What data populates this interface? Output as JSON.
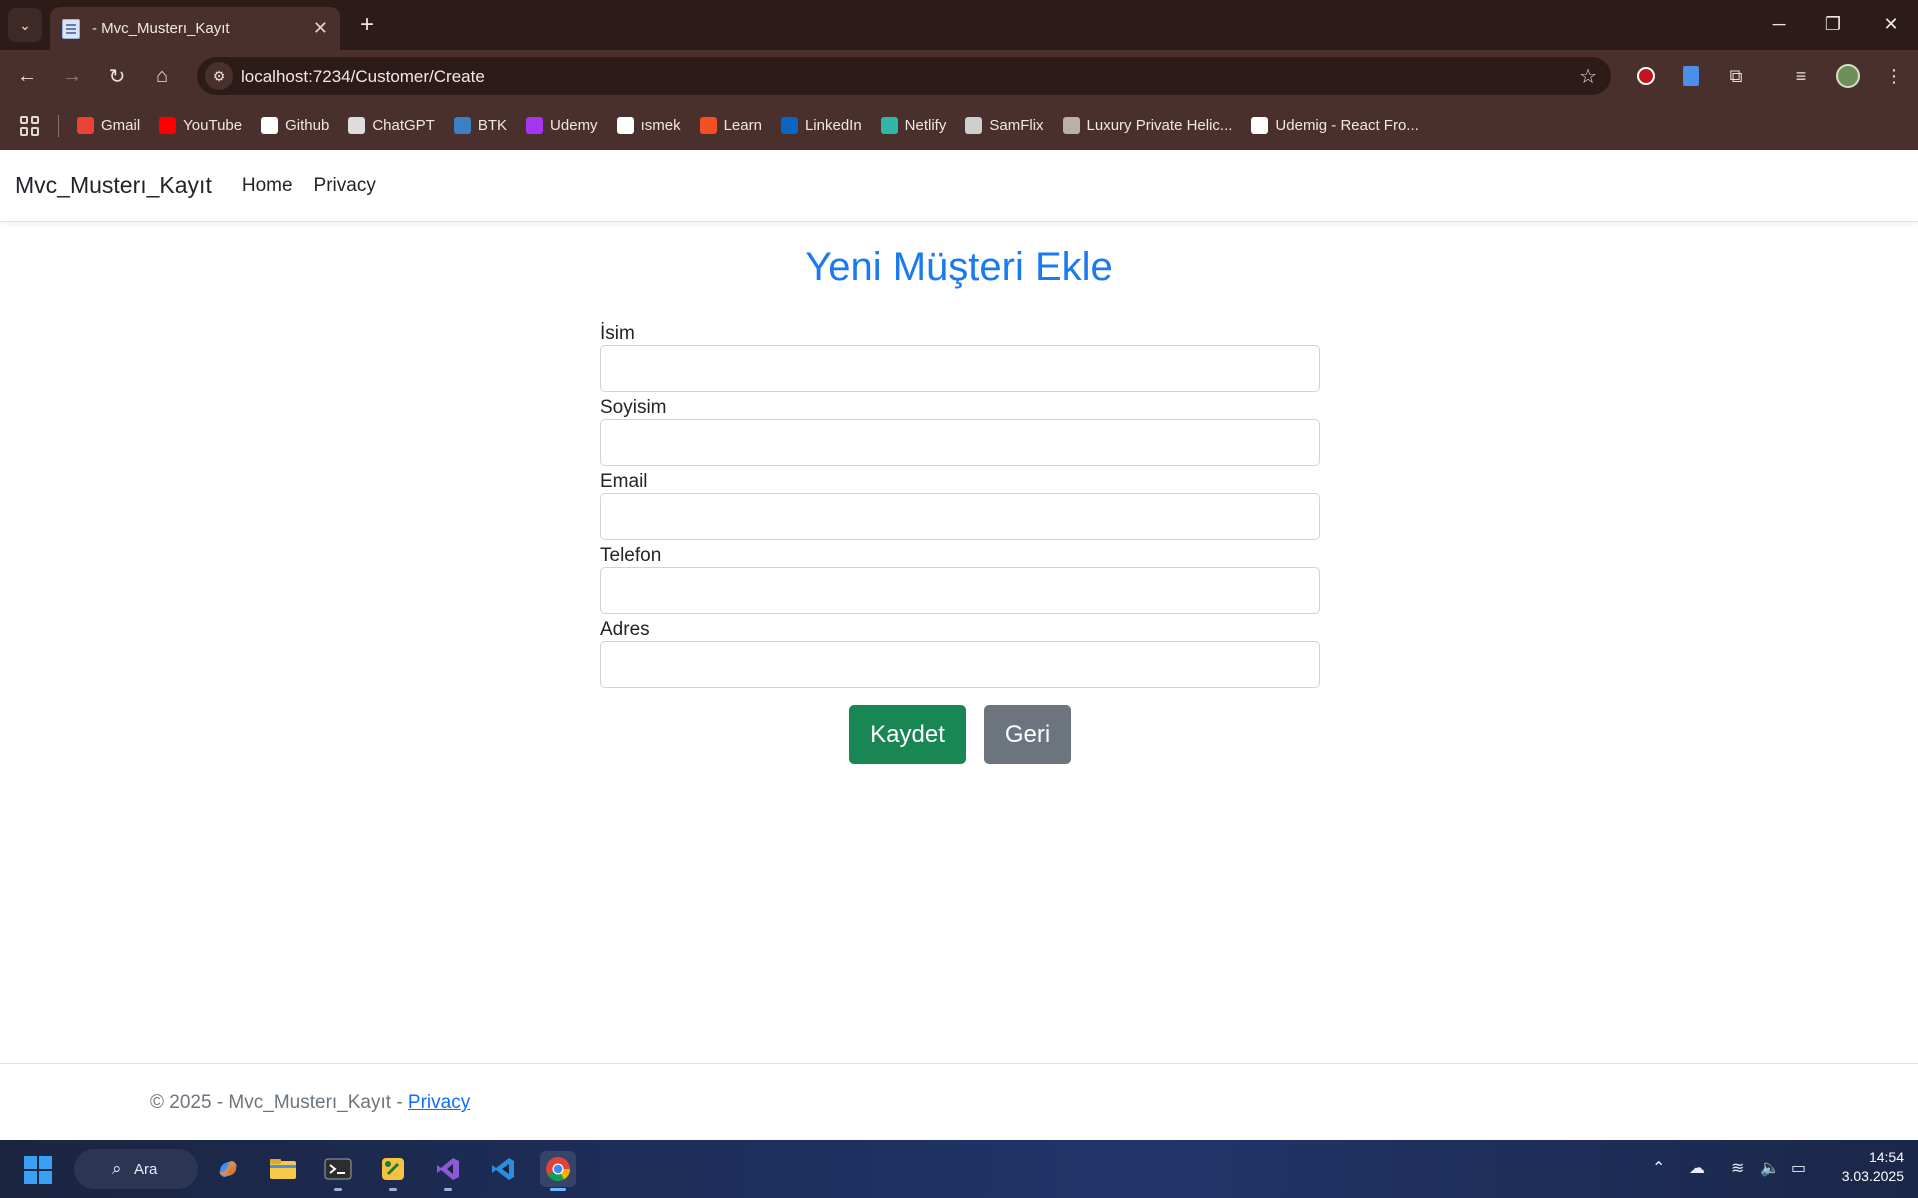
{
  "browser": {
    "tab_title": "- Mvc_Musterı_Kayıt",
    "url": "localhost:7234/Customer/Create",
    "bookmarks": [
      {
        "label": "Gmail",
        "icon": "gmail-icon",
        "color": "#ea4335"
      },
      {
        "label": "YouTube",
        "icon": "youtube-icon",
        "color": "#ff0000"
      },
      {
        "label": "Github",
        "icon": "github-icon",
        "color": "#ffffff"
      },
      {
        "label": "ChatGPT",
        "icon": "chatgpt-icon",
        "color": "#dddddd"
      },
      {
        "label": "BTK",
        "icon": "btk-icon",
        "color": "#3b7fc4"
      },
      {
        "label": "Udemy",
        "icon": "udemy-icon",
        "color": "#a435f0"
      },
      {
        "label": "ısmek",
        "icon": "ismek-icon",
        "color": "#ffffff"
      },
      {
        "label": "Learn",
        "icon": "microsoft-icon",
        "color": "#f25022"
      },
      {
        "label": "LinkedIn",
        "icon": "linkedin-icon",
        "color": "#0a66c2"
      },
      {
        "label": "Netlify",
        "icon": "netlify-icon",
        "color": "#32b6a8"
      },
      {
        "label": "SamFlix",
        "icon": "globe-icon",
        "color": "#cfcfcf"
      },
      {
        "label": "Luxury Private Helic...",
        "icon": "helicopter-icon",
        "color": "#b9b0a8"
      },
      {
        "label": "Udemig - React Fro...",
        "icon": "udemig-icon",
        "color": "#ffffff"
      }
    ]
  },
  "site": {
    "brand": "Mvc_Musterı_Kayıt",
    "nav": [
      "Home",
      "Privacy"
    ]
  },
  "form": {
    "title": "Yeni Müşteri Ekle",
    "fields": [
      {
        "label": "İsim",
        "value": ""
      },
      {
        "label": "Soyisim",
        "value": ""
      },
      {
        "label": "Email",
        "value": ""
      },
      {
        "label": "Telefon",
        "value": ""
      },
      {
        "label": "Adres",
        "value": ""
      }
    ],
    "save_label": "Kaydet",
    "back_label": "Geri",
    "save_color": "#198754",
    "back_color": "#6c757d",
    "title_color": "#1a7af0"
  },
  "footer": {
    "text": "© 2025 - Mvc_Musterı_Kayıt - ",
    "link": "Privacy"
  },
  "taskbar": {
    "search_label": "Ara",
    "time": "14:54",
    "date": "3.03.2025"
  }
}
